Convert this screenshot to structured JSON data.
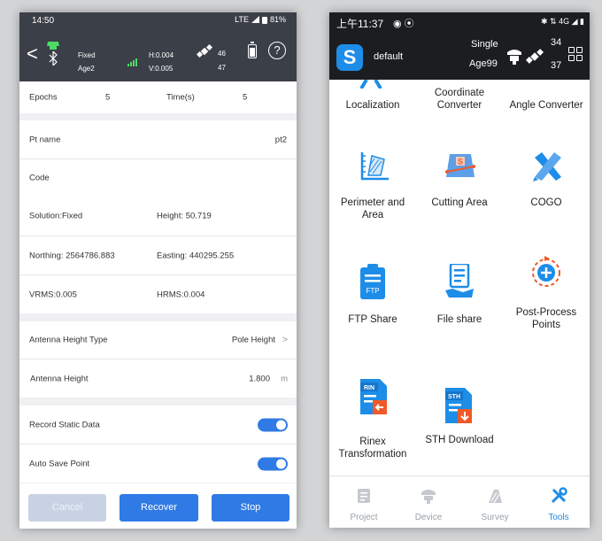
{
  "left_phone": {
    "status_bar": {
      "time": "14:50",
      "network": "LTE",
      "battery": "81%"
    },
    "header": {
      "back_label": "<",
      "solution": "Fixed",
      "age": "Age2",
      "h_precision": "H:0.004",
      "v_precision": "V:0.005",
      "sat_used": "46",
      "sat_total": "47",
      "help_label": "?"
    },
    "epochs": {
      "label": "Epochs",
      "value": "5",
      "time_label": "Time(s)",
      "time_value": "5"
    },
    "point_name": {
      "label": "Pt name",
      "value": "pt2"
    },
    "code": {
      "label": "Code",
      "value": ""
    },
    "solution": "Solution:Fixed",
    "height": "Height: 50.719",
    "northing": "Northing: 2564786.883",
    "easting": "Easting: 440295.255",
    "vrms": "VRMS:0.005",
    "hrms": "HRMS:0.004",
    "antenna_type": {
      "label": "Antenna Height Type",
      "value": "Pole Height",
      "chevron": ">"
    },
    "antenna_height": {
      "label": "Antenna Height",
      "value": "1.800",
      "unit": "m"
    },
    "record_static": {
      "label": "Record Static Data",
      "on": true
    },
    "auto_save": {
      "label": "Auto Save Point",
      "on": true
    },
    "buttons": {
      "cancel": "Cancel",
      "recover": "Recover",
      "stop": "Stop"
    },
    "colors": {
      "header": "#3b3f47",
      "accent": "#2f7ae5",
      "disabled": "#c8d2e3"
    }
  },
  "right_phone": {
    "status_bar": {
      "time": "上午11:37",
      "network": "4G"
    },
    "header": {
      "project": "default",
      "mode": "Single",
      "age": "Age99",
      "sat_used": "34",
      "sat_total": "37"
    },
    "tools": [
      {
        "label": "Localization",
        "icon": "localization-icon"
      },
      {
        "label": "Coordinate Converter",
        "icon": "coordinate-converter-icon"
      },
      {
        "label": "Angle Converter",
        "icon": "angle-converter-icon"
      },
      {
        "label": "Perimeter and Area",
        "icon": "perimeter-area-icon"
      },
      {
        "label": "Cutting Area",
        "icon": "cutting-area-icon"
      },
      {
        "label": "COGO",
        "icon": "cogo-icon"
      },
      {
        "label": "FTP Share",
        "icon": "ftp-share-icon"
      },
      {
        "label": "File share",
        "icon": "file-share-icon"
      },
      {
        "label": "Post-Process Points",
        "icon": "post-process-icon"
      },
      {
        "label": "Rinex Transformation",
        "icon": "rinex-icon"
      },
      {
        "label": "STH Download",
        "icon": "sth-download-icon"
      }
    ],
    "icon_text": {
      "cutting": "S",
      "ftp": "FTP",
      "rinex": "RIN",
      "sth": "STH"
    },
    "tabs": [
      {
        "label": "Project",
        "active": false
      },
      {
        "label": "Device",
        "active": false
      },
      {
        "label": "Survey",
        "active": false
      },
      {
        "label": "Tools",
        "active": true
      }
    ],
    "colors": {
      "accent": "#1d8de8",
      "header": "#1b1d21",
      "icon_orange": "#f05a28"
    }
  }
}
